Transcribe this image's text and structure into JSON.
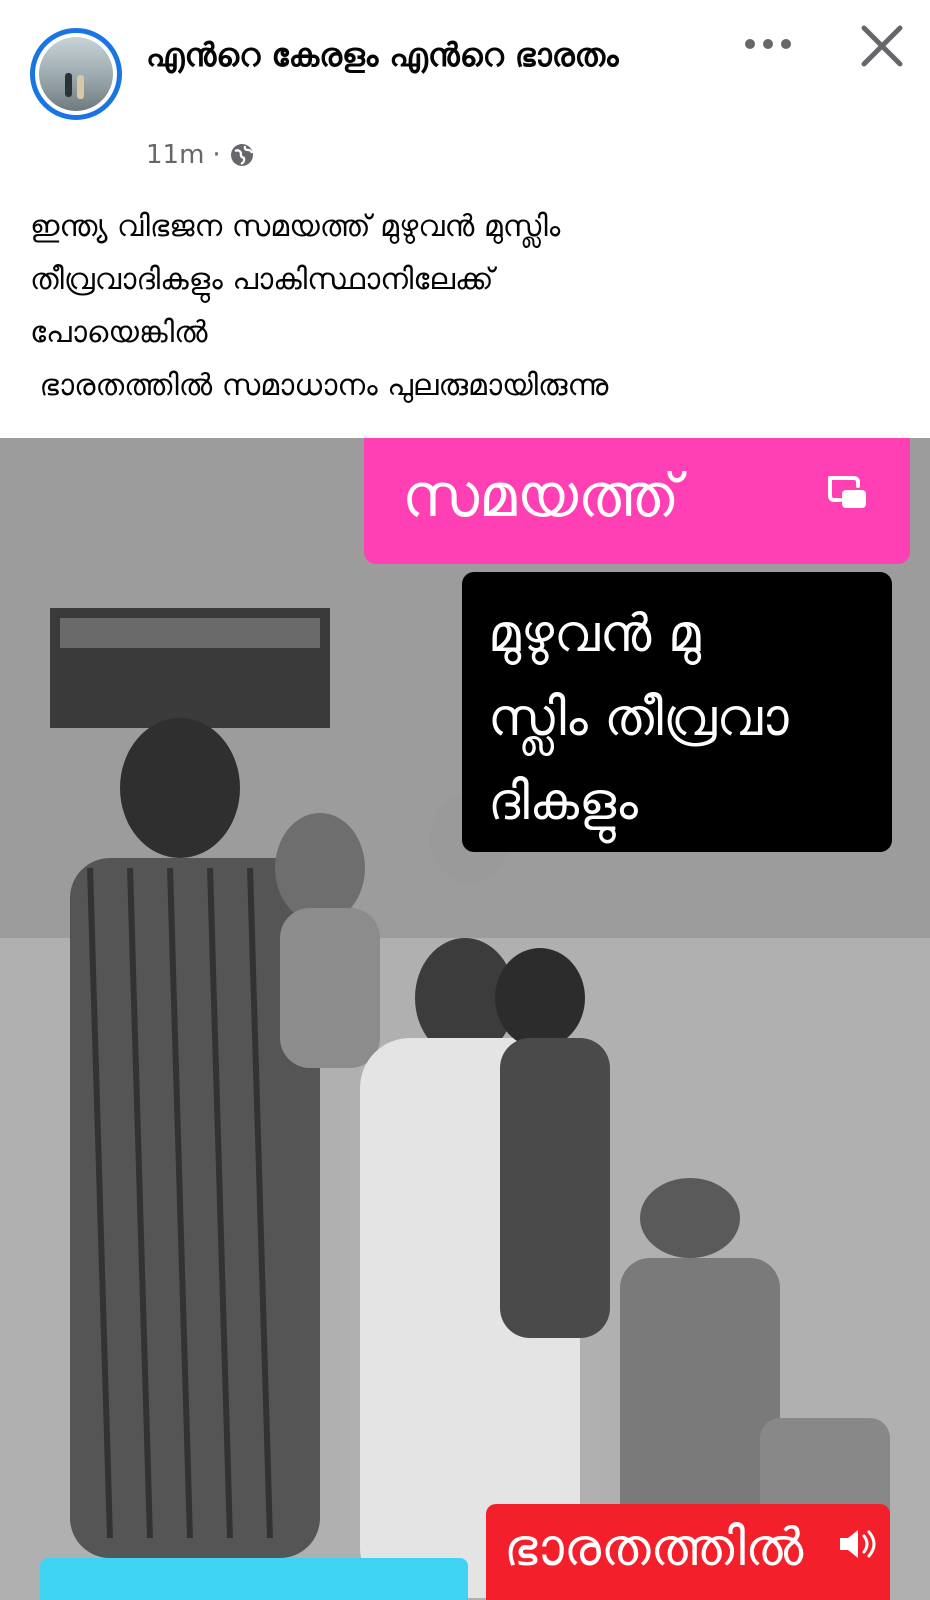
{
  "header": {
    "page_name": "എൻറെ കേരളം എൻറെ ഭാരതം",
    "time": "11m",
    "separator": "·",
    "privacy_icon": "globe-icon",
    "more_icon": "more-horizontal-icon",
    "close_icon": "close-icon"
  },
  "post": {
    "lines": [
      "ഇന്ത്യ വിഭജന സമയത്ത് മുഴുവൻ മുസ്ലിം",
      "തീവ്രവാദികളും പാകിസ്ഥാനിലേക്ക്",
      "പോയെങ്കിൽ",
      " ഭാരതത്തിൽ സമാധാനം പുലരുമായിരുന്നു"
    ]
  },
  "video": {
    "pink_caption": "സമയത്ത്",
    "black_caption_lines": [
      "മുഴുവൻ മു",
      "സ്ലിം തീവ്രവാ",
      "ദികളും"
    ],
    "red_caption": "ഭാരതത്തിൽ",
    "pip_icon": "picture-in-picture-icon",
    "sound_icon": "speaker-icon",
    "colors": {
      "pink": "#ff3fb4",
      "black": "#000000",
      "red": "#f31f2a",
      "cyan": "#3ed3f2"
    }
  }
}
